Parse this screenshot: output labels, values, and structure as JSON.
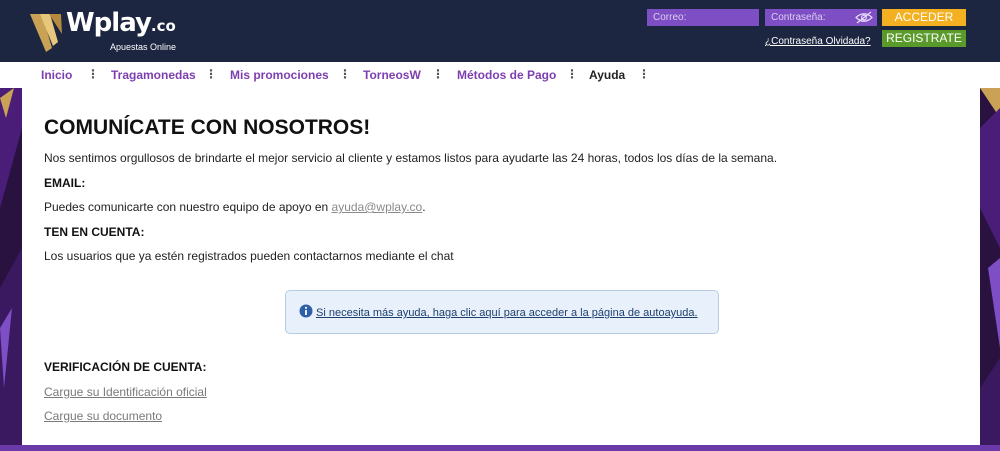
{
  "header": {
    "logo_text": "Wplay",
    "logo_tld": ".co",
    "logo_subtitle": "Apuestas Online",
    "email_placeholder": "Correo:",
    "password_placeholder": "Contraseña:",
    "login_label": "ACCEDER",
    "register_label": "REGISTRATE",
    "forgot_password": "¿Contraseña Olvidada?",
    "password_toggle_icon": "eye-icon"
  },
  "nav": {
    "items": [
      {
        "label": "Inicio"
      },
      {
        "label": "Tragamonedas"
      },
      {
        "label": "Mis promociones"
      },
      {
        "label": "TorneosW"
      },
      {
        "label": "Métodos de Pago"
      },
      {
        "label": "Ayuda"
      }
    ],
    "separator": "⋮",
    "active_index": 5
  },
  "main": {
    "title": "COMUNÍCATE CON NOSOTROS!",
    "intro": "Nos sentimos orgullosos de brindarte el mejor servicio al cliente y estamos listos para ayudarte las 24 horas, todos los días de la semana.",
    "email_heading": "EMAIL:",
    "email_text_prefix": "Puedes comunicarte con nuestro equipo de apoyo en ",
    "email_address": "ayuda@wplay.co",
    "email_text_suffix": ".",
    "note_heading": "TEN EN CUENTA:",
    "note_text": "Los usuarios que ya estén registrados pueden contactarnos mediante el chat",
    "help_text": "Si necesita más ayuda, haga clic aquí para acceder a la página de autoayuda.",
    "verification_heading": "VERIFICACIÓN DE CUENTA:",
    "upload_id_link": "Cargue su Identificación oficial",
    "upload_doc_link": "Cargue su documento"
  },
  "colors": {
    "header_bg": "#1d2640",
    "nav_link": "#7d3fb0",
    "field_bg": "#7d4ec4",
    "login_button": "#f3b021",
    "register_button": "#5a9a2b",
    "help_box_bg": "#e7f0fb"
  }
}
